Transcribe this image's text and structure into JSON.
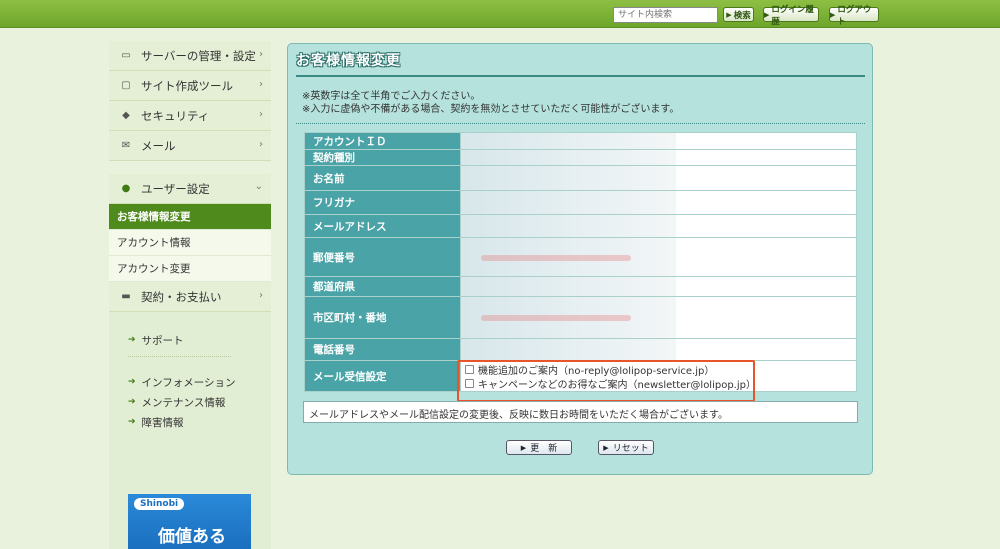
{
  "header": {
    "search_placeholder": "サイト内検索",
    "search_button": "検索",
    "login_history_button": "ログイン履歴",
    "logout_button": "ログアウト"
  },
  "sidebar": {
    "main_items": [
      {
        "label": "サーバーの管理・設定",
        "icon": "server-icon"
      },
      {
        "label": "サイト作成ツール",
        "icon": "laptop-icon"
      },
      {
        "label": "セキュリティ",
        "icon": "shield-icon"
      },
      {
        "label": "メール",
        "icon": "mail-icon"
      }
    ],
    "user_settings": {
      "label": "ユーザー設定",
      "icon": "user-icon"
    },
    "sub_items": [
      "お客様情報変更",
      "アカウント情報",
      "アカウント変更"
    ],
    "contract": {
      "label": "契約・お支払い",
      "icon": "card-icon"
    },
    "support_links": [
      "サポート"
    ],
    "info_links": [
      "インフォメーション",
      "メンテナンス情報",
      "障害情報"
    ],
    "banner": {
      "logo": "Shinobi",
      "text": "価値ある"
    }
  },
  "main": {
    "title": "お客様情報変更",
    "notes": [
      "※英数字は全て半角でご入力ください。",
      "※入力に虚偽や不備がある場合、契約を無効とさせていただく可能性がございます。"
    ],
    "fields": [
      "アカウントＩＤ",
      "契約種別",
      "お名前",
      "フリガナ",
      "メールアドレス",
      "郵便番号",
      "都道府県",
      "市区町村・番地",
      "電話番号",
      "メール受信設定"
    ],
    "mail_options": [
      "機能追加のご案内（no-reply@lolipop-service.jp）",
      "キャンペーンなどのお得なご案内（newsletter@lolipop.jp）"
    ],
    "info_text": "メールアドレスやメール配信設定の変更後、反映に数日お時間をいただく場合がございます。",
    "update_button": "更　新",
    "reset_button": "リセット"
  },
  "colors": {
    "topbar": "#7db33a",
    "active_sub": "#4f8b1c",
    "panel_bg": "#b5e2dd",
    "label_bg": "#4aa3a6",
    "highlight": "#e8552a"
  }
}
